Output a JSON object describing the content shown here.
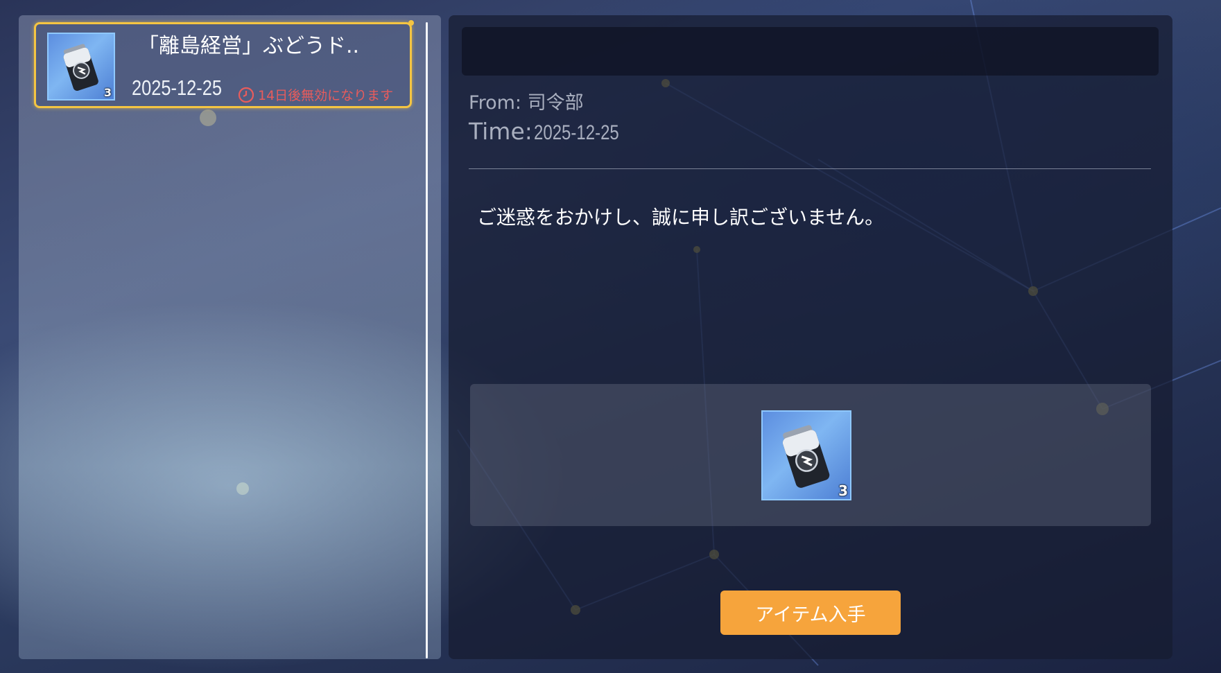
{
  "mail_list": {
    "items": [
      {
        "title": "「離島経営」ぶどうド..",
        "date": "2025-12-25",
        "expire_text": "14日後無効になります",
        "item_icon": "energy-drink-can-icon",
        "item_count": "3",
        "selected": true
      }
    ]
  },
  "mail_detail": {
    "subject": "",
    "from_label": "From: ",
    "from_value": "司令部",
    "time_label": "Time:",
    "time_value": "2025-12-25",
    "body": "ご迷惑をおかけし、誠に申し訳ございません。",
    "attachments": [
      {
        "icon": "energy-drink-can-icon",
        "count": "3"
      }
    ],
    "claim_button_label": "アイテム入手"
  },
  "colors": {
    "selected_border": "#f5c542",
    "expire_text": "#e85c5c",
    "claim_button": "#f6a43c",
    "item_background": "#6a9ee6"
  }
}
